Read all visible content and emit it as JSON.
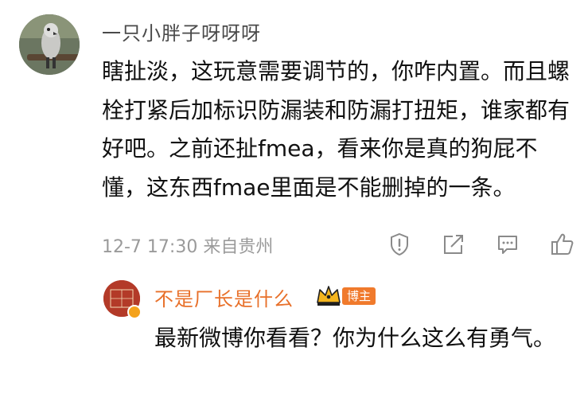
{
  "comment": {
    "username": "一只小胖子呀呀呀",
    "text": "瞎扯淡，这玩意需要调节的，你咋内置。而且螺栓打紧后加标识防漏装和防漏打扭矩，谁家都有好吧。之前还扯fmea，看来你是真的狗屁不懂，这东西fmae里面是不能删掉的一条。",
    "meta": "12-7 17:30 来自贵州",
    "actions": [
      "report-icon",
      "share-icon",
      "comment-icon",
      "like-icon"
    ]
  },
  "reply": {
    "username": "不是厂长是什么",
    "badge": "博主",
    "text": "最新微博你看看？你为什么这么有勇气。"
  },
  "colors": {
    "username_reply": "#e8702a",
    "badge_bg": "#f07a2c",
    "meta": "#9a9a9a"
  }
}
